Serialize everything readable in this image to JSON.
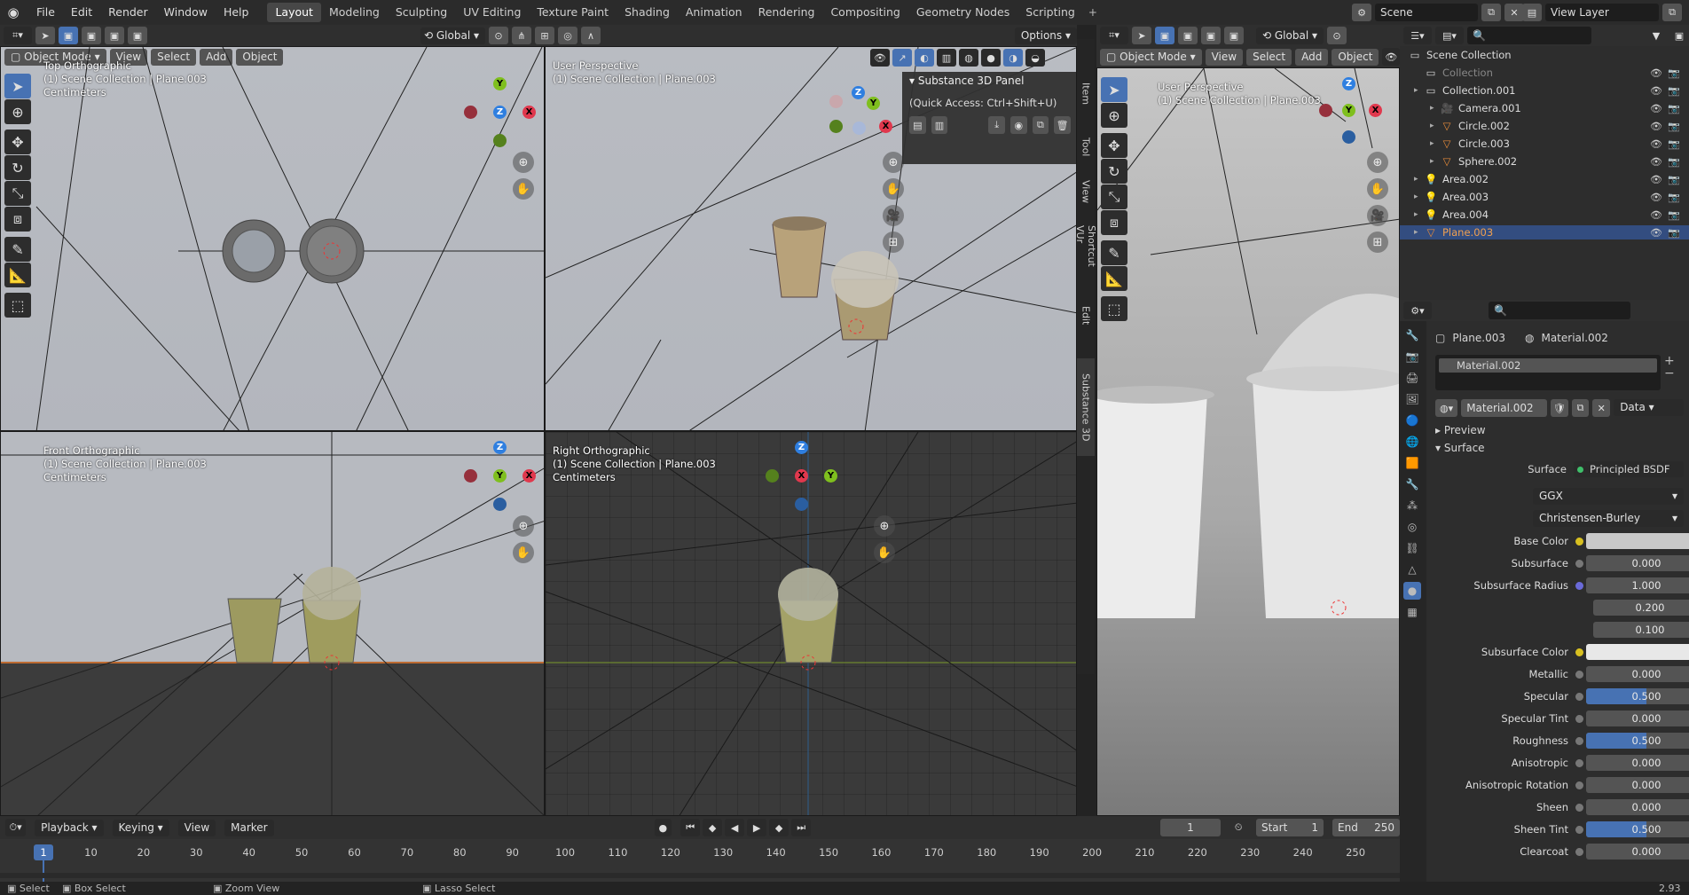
{
  "menu": [
    "File",
    "Edit",
    "Render",
    "Window",
    "Help"
  ],
  "workspaces": [
    "Layout",
    "Modeling",
    "Sculpting",
    "UV Editing",
    "Texture Paint",
    "Shading",
    "Animation",
    "Rendering",
    "Compositing",
    "Geometry Nodes",
    "Scripting"
  ],
  "active_workspace": "Layout",
  "add_tab_icon": "+",
  "scene": "Scene",
  "view_layer": "View Layer",
  "header": {
    "mode": "Object Mode",
    "view": "View",
    "select": "Select",
    "add": "Add",
    "object": "Object",
    "orientation": "Global",
    "options": "Options",
    "orientation2": "Global"
  },
  "viewports": {
    "top": {
      "line1": "Top Orthographic",
      "line2": "(1) Scene Collection | Plane.003",
      "line3": "Centimeters"
    },
    "user": {
      "line1": "User Perspective",
      "line2": "(1) Scene Collection | Plane.003"
    },
    "front": {
      "line1": "Front Orthographic",
      "line2": "(1) Scene Collection | Plane.003",
      "line3": "Centimeters"
    },
    "right": {
      "line1": "Right Orthographic",
      "line2": "(1) Scene Collection | Plane.003",
      "line3": "Centimeters"
    },
    "right_user": {
      "line1": "User Perspective",
      "line2": "(1) Scene Collection | Plane.003"
    }
  },
  "axes": {
    "x": "X",
    "y": "Y",
    "z": "Z"
  },
  "substance": {
    "title": "Substance 3D Panel",
    "quick": "(Quick Access: Ctrl+Shift+U)"
  },
  "side_tabs": [
    "Item",
    "Tool",
    "View",
    "Shortcut VUr",
    "Edit",
    "Substance 3D"
  ],
  "outliner": {
    "search_placeholder": "",
    "rows": [
      {
        "label": "Scene Collection",
        "indent": 0,
        "icon": "collection-icon"
      },
      {
        "label": "Collection",
        "indent": 1,
        "icon": "collection-icon",
        "dim": true
      },
      {
        "label": "Collection.001",
        "indent": 1,
        "icon": "collection-icon"
      },
      {
        "label": "Camera.001",
        "indent": 2,
        "icon": "camera-icon"
      },
      {
        "label": "Circle.002",
        "indent": 2,
        "icon": "mesh-icon"
      },
      {
        "label": "Circle.003",
        "indent": 2,
        "icon": "mesh-icon"
      },
      {
        "label": "Sphere.002",
        "indent": 2,
        "icon": "mesh-icon"
      },
      {
        "label": "Area.002",
        "indent": 1,
        "icon": "light-icon"
      },
      {
        "label": "Area.003",
        "indent": 1,
        "icon": "light-icon"
      },
      {
        "label": "Area.004",
        "indent": 1,
        "icon": "light-icon"
      },
      {
        "label": "Plane.003",
        "indent": 1,
        "icon": "mesh-icon",
        "selected": true
      }
    ]
  },
  "properties": {
    "object": "Plane.003",
    "material": "Material.002",
    "slot": "Material.002",
    "mat_field": "Material.002",
    "link": "Data",
    "preview": "Preview",
    "surface_section": "Surface",
    "surface_label": "Surface",
    "surface_value": "Principled BSDF",
    "distribution": "GGX",
    "subsurface_method": "Christensen-Burley",
    "rows": [
      {
        "label": "Base Color",
        "type": "color",
        "color": "#c9c9c9",
        "dot": "#d8c020"
      },
      {
        "label": "Subsurface",
        "value": "0.000"
      },
      {
        "label": "Subsurface Radius",
        "value": "1.000",
        "dot": "#6a6ad8"
      },
      {
        "label": "",
        "value": "0.200",
        "sub": true
      },
      {
        "label": "",
        "value": "0.100",
        "sub": true
      },
      {
        "label": "Subsurface Color",
        "type": "color",
        "color": "#e8e8e8",
        "dot": "#d8c020"
      },
      {
        "label": "Metallic",
        "value": "0.000"
      },
      {
        "label": "Specular",
        "value": "0.500",
        "fill": 0.5
      },
      {
        "label": "Specular Tint",
        "value": "0.000"
      },
      {
        "label": "Roughness",
        "value": "0.500",
        "fill": 0.5
      },
      {
        "label": "Anisotropic",
        "value": "0.000"
      },
      {
        "label": "Anisotropic Rotation",
        "value": "0.000"
      },
      {
        "label": "Sheen",
        "value": "0.000"
      },
      {
        "label": "Sheen Tint",
        "value": "0.500",
        "fill": 0.5
      },
      {
        "label": "Clearcoat",
        "value": "0.000"
      }
    ]
  },
  "timeline": {
    "playback": "Playback",
    "keying": "Keying",
    "view": "View",
    "marker": "Marker",
    "current": "1",
    "start_label": "Start",
    "start": "1",
    "end_label": "End",
    "end": "250",
    "frame_marker": "1",
    "ticks": [
      "10",
      "20",
      "30",
      "40",
      "50",
      "60",
      "70",
      "80",
      "90",
      "100",
      "110",
      "120",
      "130",
      "140",
      "150",
      "160",
      "170",
      "180",
      "190",
      "200",
      "210",
      "220",
      "230",
      "240",
      "250"
    ]
  },
  "statusbar": {
    "select": "Select",
    "box_select": "Box Select",
    "zoom_view": "Zoom View",
    "lasso_select": "Lasso Select",
    "version": "2.93"
  }
}
